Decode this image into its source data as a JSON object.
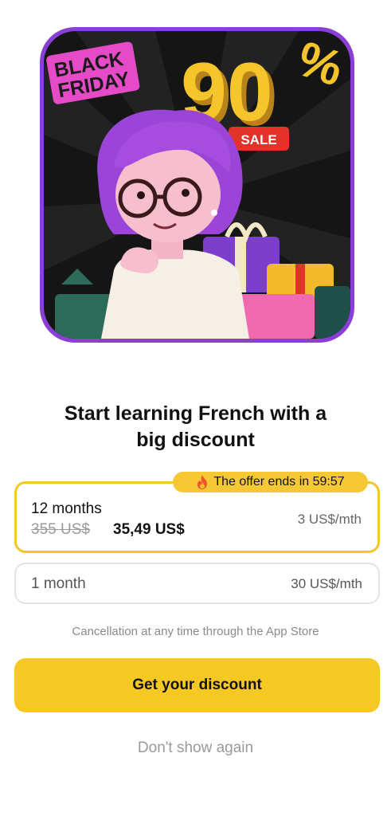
{
  "hero": {
    "badge_line1": "BLACK",
    "badge_line2": "FRIDAY",
    "percent_number": "90",
    "percent_sign": "%",
    "sale_tag": "SALE"
  },
  "headline": {
    "line1": "Start learning French with a",
    "line2": "big discount"
  },
  "offer_badge": {
    "icon": "fire-icon",
    "text": "The offer ends in 59:57"
  },
  "plans": [
    {
      "title": "12 months",
      "old_price": "355 US$",
      "new_price": "35,49 US$",
      "rate": "3 US$/mth",
      "selected": true
    },
    {
      "title": "1 month",
      "rate": "30 US$/mth",
      "selected": false
    }
  ],
  "cancellation_note": "Cancellation at any time through the App Store",
  "cta_label": "Get your discount",
  "dismiss_label": "Don't show again",
  "colors": {
    "accent": "#f5c823",
    "hero_border": "#8a3fd6"
  }
}
